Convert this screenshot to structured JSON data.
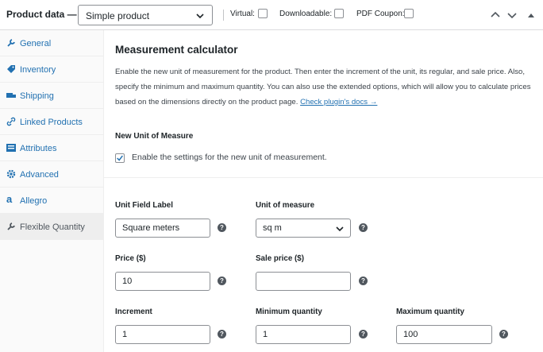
{
  "header": {
    "title": "Product data —",
    "product_type": "Simple product",
    "options": [
      {
        "label": "Virtual:",
        "checked": false
      },
      {
        "label": "Downloadable:",
        "checked": false
      },
      {
        "label": "PDF Coupon:",
        "checked": false
      }
    ]
  },
  "sidebar": {
    "items": [
      {
        "label": "General",
        "icon": "wrench-icon"
      },
      {
        "label": "Inventory",
        "icon": "tag-icon"
      },
      {
        "label": "Shipping",
        "icon": "truck-icon"
      },
      {
        "label": "Linked Products",
        "icon": "link-icon"
      },
      {
        "label": "Attributes",
        "icon": "list-icon"
      },
      {
        "label": "Advanced",
        "icon": "gear-icon"
      },
      {
        "label": "Allegro",
        "icon": "allegro-icon"
      },
      {
        "label": "Flexible Quantity",
        "icon": "wrench-icon",
        "active": true
      }
    ]
  },
  "main": {
    "title": "Measurement calculator",
    "description": "Enable the new unit of measurement for the product. Then enter the increment of the unit, its regular, and sale price. Also, specify the minimum and maximum quantity. You can also use the extended options, which will allow you to calculate prices based on the dimensions directly on the product page.",
    "docs_link": "Check plugin's docs →",
    "section_label": "New Unit of Measure",
    "enable_checkbox": {
      "label": "Enable the settings for the new unit of measurement.",
      "checked": true
    },
    "fields": {
      "unit_field_label": {
        "label": "Unit Field Label",
        "value": "Square meters"
      },
      "unit_of_measure": {
        "label": "Unit of measure",
        "value": "sq m"
      },
      "price": {
        "label": "Price ($)",
        "value": "10"
      },
      "sale_price": {
        "label": "Sale price ($)",
        "value": ""
      },
      "increment": {
        "label": "Increment",
        "value": "1"
      },
      "minimum_quantity": {
        "label": "Minimum quantity",
        "value": "1"
      },
      "maximum_quantity": {
        "label": "Maximum quantity",
        "value": "100"
      }
    }
  },
  "colors": {
    "link": "#2271b1",
    "accent": "#2271b1",
    "text": "#1d2327"
  }
}
